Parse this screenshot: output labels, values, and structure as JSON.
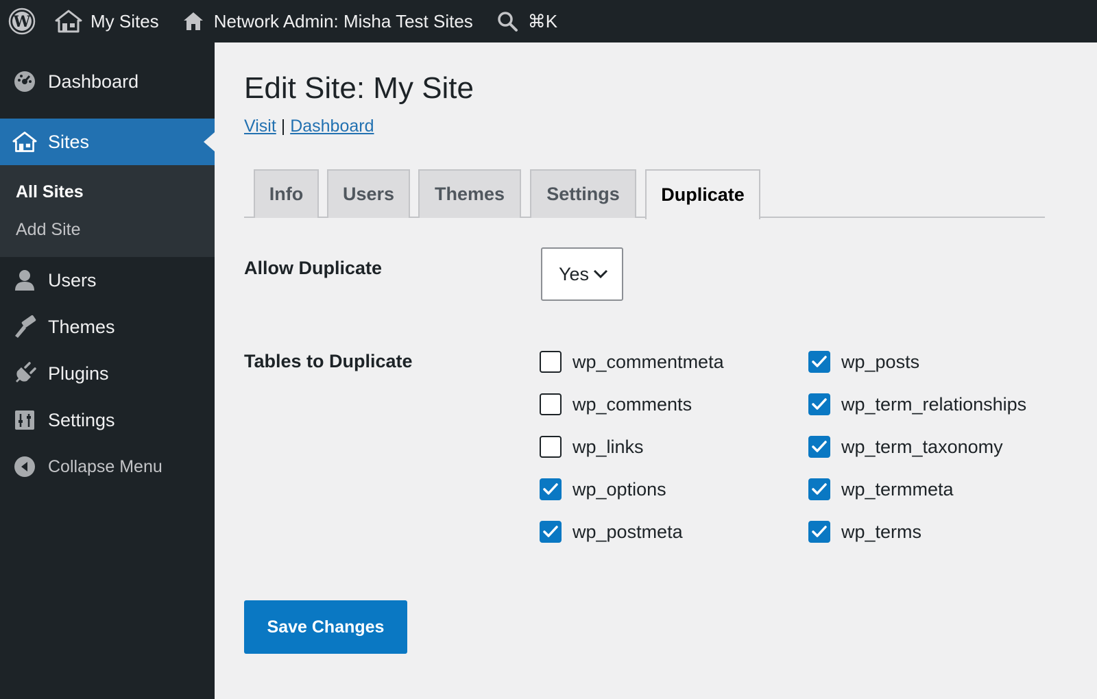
{
  "adminbar": {
    "my_sites": "My Sites",
    "network_admin": "Network Admin: Misha Test Sites",
    "search_shortcut": "⌘K"
  },
  "sidebar": {
    "dashboard": "Dashboard",
    "sites": "Sites",
    "sites_sub": [
      "All Sites",
      "Add Site"
    ],
    "users": "Users",
    "themes": "Themes",
    "plugins": "Plugins",
    "settings": "Settings",
    "collapse": "Collapse Menu"
  },
  "main": {
    "title": "Edit Site: My Site",
    "visit_link": "Visit",
    "separator": "|",
    "dashboard_link": "Dashboard",
    "tabs": [
      "Info",
      "Users",
      "Themes",
      "Settings",
      "Duplicate"
    ],
    "active_tab": "Duplicate",
    "allow_duplicate_label": "Allow Duplicate",
    "allow_duplicate_value": "Yes",
    "tables_label": "Tables to Duplicate",
    "tables": [
      {
        "name": "wp_commentmeta",
        "checked": false
      },
      {
        "name": "wp_comments",
        "checked": false
      },
      {
        "name": "wp_links",
        "checked": false
      },
      {
        "name": "wp_options",
        "checked": true
      },
      {
        "name": "wp_postmeta",
        "checked": true
      },
      {
        "name": "wp_posts",
        "checked": true
      },
      {
        "name": "wp_term_relationships",
        "checked": true
      },
      {
        "name": "wp_term_taxonomy",
        "checked": true
      },
      {
        "name": "wp_termmeta",
        "checked": true
      },
      {
        "name": "wp_terms",
        "checked": true
      }
    ],
    "save_label": "Save Changes"
  },
  "colors": {
    "adminbar_bg": "#1d2327",
    "accent": "#2271b1",
    "checkbox_checked": "#0a78c3",
    "content_bg": "#f0f0f1"
  }
}
